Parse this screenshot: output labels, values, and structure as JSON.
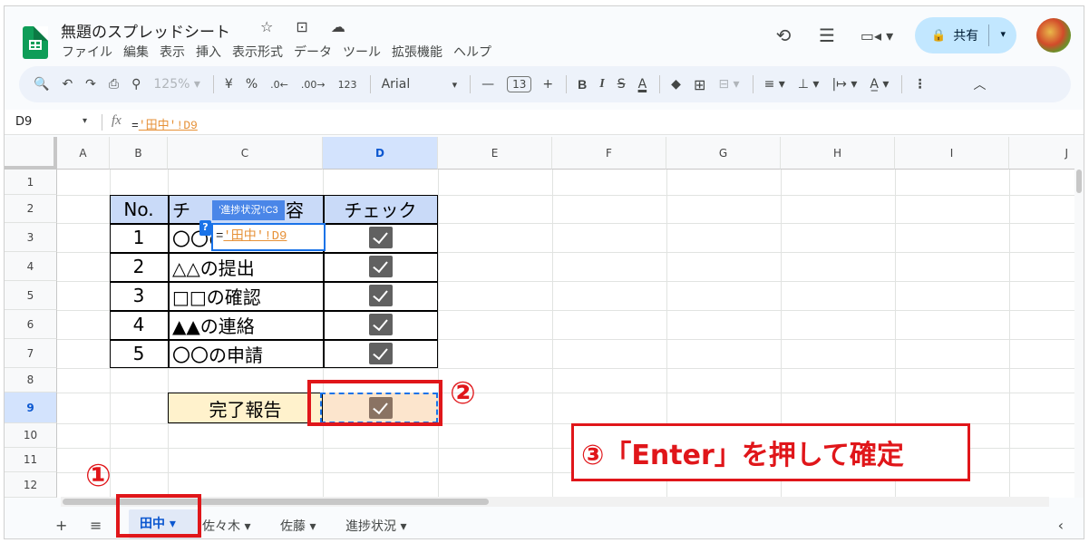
{
  "header": {
    "title": "無題のスプレッドシート",
    "title_icons": "☆ ⊡ ☁",
    "menu": [
      "ファイル",
      "編集",
      "表示",
      "挿入",
      "表示形式",
      "データ",
      "ツール",
      "拡張機能",
      "ヘルプ"
    ],
    "history_icon": "⟲",
    "comment_icon": "☰",
    "meet_icon": "▭◂ ▾",
    "share_label": "共有",
    "share_lock": "🔒",
    "share_dropdown": "▾"
  },
  "toolbar": {
    "search": "🔍",
    "undo": "↶",
    "redo": "↷",
    "print": "⎙",
    "paint_format": "⚲",
    "zoom": "125%",
    "zoom_dd": "▾",
    "currency": "¥",
    "percent": "%",
    "dec_decrease": ".0←",
    "dec_increase": ".00→",
    "number_format": "123",
    "font": "Arial",
    "font_dd": "▾",
    "font_minus": "—",
    "font_size": "13",
    "font_plus": "+",
    "bold": "B",
    "italic": "I",
    "strike": "S",
    "text_color": "A",
    "fill_color": "◆",
    "borders": "⊞",
    "merge": "⊟ ▾",
    "halign": "≡ ▾",
    "valign": "⊥ ▾",
    "wrap": "|↦ ▾",
    "rotate": "A̲ ▾",
    "more": "⋮",
    "collapse": "︿"
  },
  "formula_bar": {
    "name_box": "D9",
    "name_dd": "▾",
    "fx": "fx",
    "formula_prefix": "=",
    "formula_ref": "'田中'!D9"
  },
  "grid": {
    "columns": [
      "A",
      "B",
      "C",
      "D",
      "E",
      "F",
      "G",
      "H",
      "I",
      "J"
    ],
    "rows": [
      "1",
      "2",
      "3",
      "4",
      "5",
      "6",
      "7",
      "8",
      "9",
      "10",
      "11",
      "12"
    ],
    "table": {
      "headers": [
        "No.",
        "チェック内容",
        "チェック"
      ],
      "rows": [
        {
          "no": "1",
          "item": "〇〇の"
        },
        {
          "no": "2",
          "item": "△△の提出"
        },
        {
          "no": "3",
          "item": "□□の確認"
        },
        {
          "no": "4",
          "item": "▲▲の連絡"
        },
        {
          "no": "5",
          "item": "〇〇の申請"
        }
      ],
      "header_c_visible": "チ",
      "header_c_tail": "容"
    },
    "report_label": "完了報告",
    "editor_prefix": "=",
    "editor_ref": "'田中'!D9",
    "tooltip_ref": "'進捗状況'!C3",
    "tooltip_q": "?"
  },
  "annotations": {
    "step1": "①",
    "step2": "②",
    "step3": "③「Enter」を押して確定"
  },
  "sheet_tabs": {
    "add": "+",
    "all_sheets": "≡",
    "tabs": [
      "田中 ▾",
      "佐々木 ▾",
      "佐藤 ▾",
      "進捗状況 ▾"
    ],
    "scroll": "‹"
  }
}
